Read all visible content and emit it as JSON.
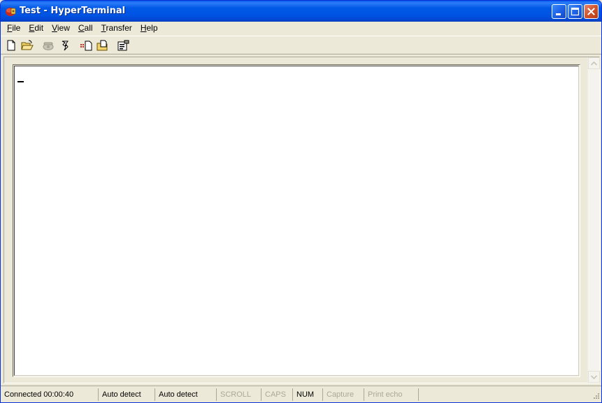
{
  "window": {
    "title": "Test - HyperTerminal",
    "accent_color": "#0054E3",
    "close_color": "#D2532C"
  },
  "menu": {
    "items": [
      {
        "label_prefix": "",
        "mnemonic": "F",
        "label_rest": "ile"
      },
      {
        "label_prefix": "",
        "mnemonic": "E",
        "label_rest": "dit"
      },
      {
        "label_prefix": "",
        "mnemonic": "V",
        "label_rest": "iew"
      },
      {
        "label_prefix": "",
        "mnemonic": "C",
        "label_rest": "all"
      },
      {
        "label_prefix": "",
        "mnemonic": "T",
        "label_rest": "ransfer"
      },
      {
        "label_prefix": "",
        "mnemonic": "H",
        "label_rest": "elp"
      }
    ]
  },
  "toolbar": {
    "buttons": [
      "new-document-icon",
      "open-folder-icon",
      "call-phone-icon",
      "disconnect-icon",
      "send-file-icon",
      "receive-file-icon",
      "properties-icon"
    ]
  },
  "terminal": {
    "cursor_char": "_"
  },
  "status": {
    "connected": "Connected 00:00:40",
    "detect1": "Auto detect",
    "detect2": "Auto detect",
    "scroll": "SCROLL",
    "caps": "CAPS",
    "num": "NUM",
    "capture": "Capture",
    "print_echo": "Print echo"
  }
}
